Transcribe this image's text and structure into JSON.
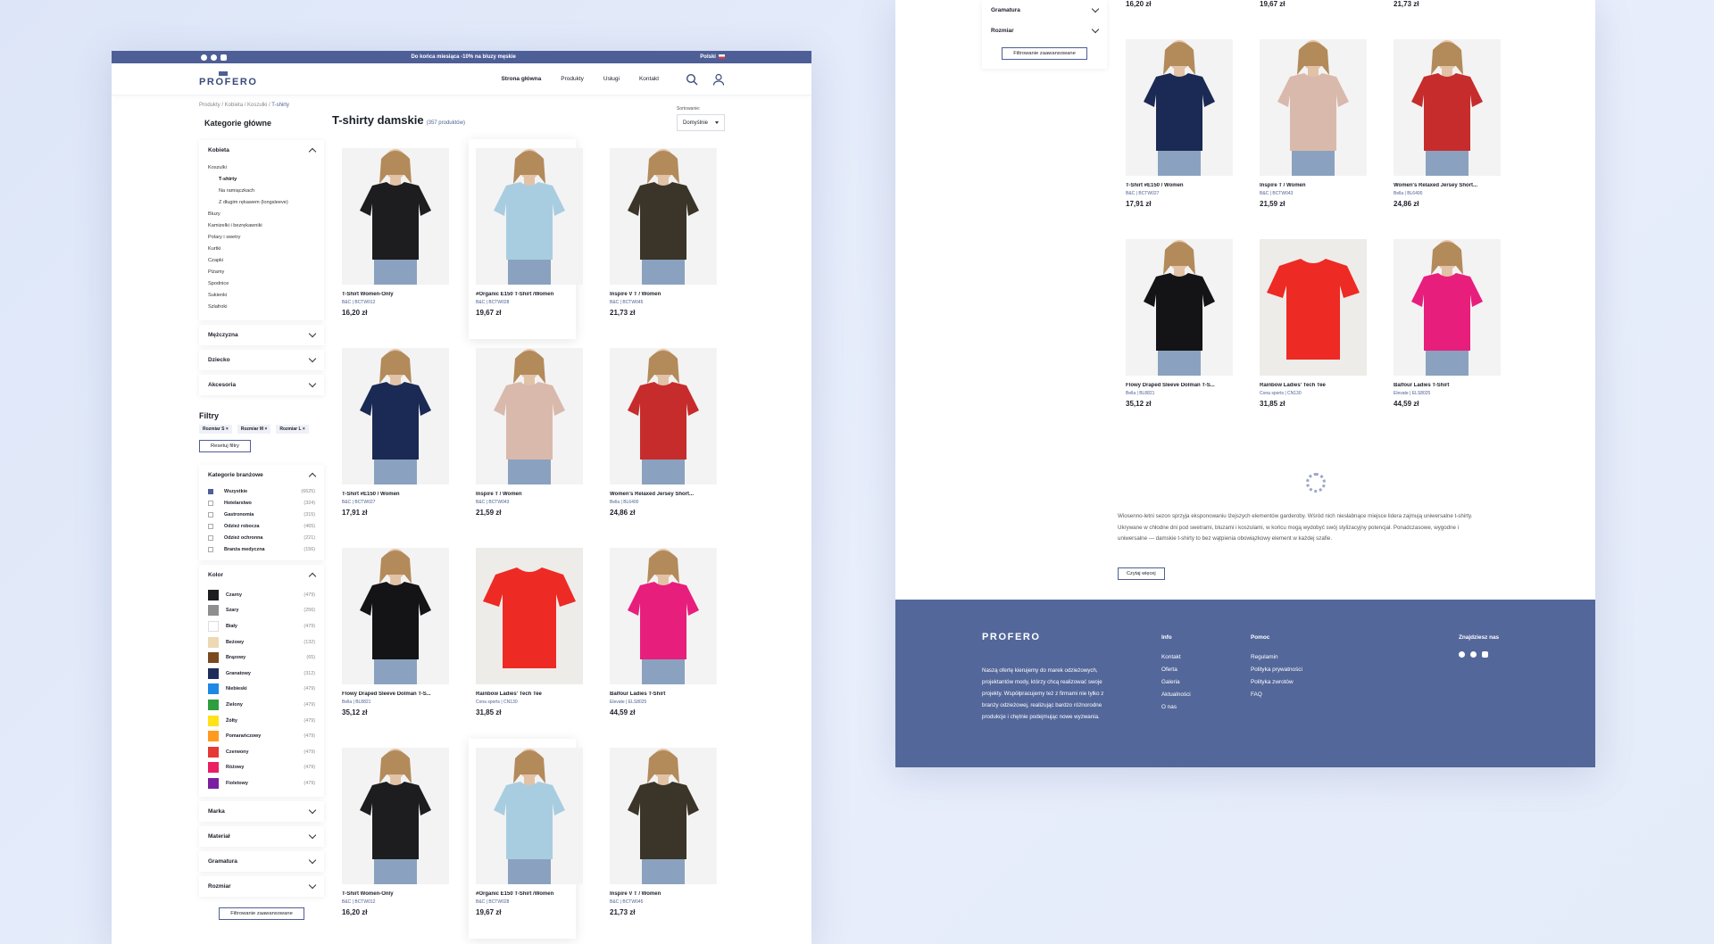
{
  "topbar": {
    "promo": "Do końca miesiąca -10% na bluzy męskie",
    "lang": "Polski"
  },
  "brand": {
    "logo": "PROFERO",
    "accent": "#4d5f96",
    "footer_bg": "#53679a"
  },
  "nav": {
    "items": [
      "Strona główna",
      "Produkty",
      "Usługi",
      "Kontakt"
    ],
    "active": "Strona główna",
    "icons": [
      "search-icon",
      "user-icon"
    ]
  },
  "breadcrumb": {
    "path": "Produkty / Kobieta / Koszulki / ",
    "current": "T-shirty"
  },
  "sidebar": {
    "heading": "Kategorie główne",
    "kobieta": "Kobieta",
    "tree": [
      "Koszulki",
      "T-shirty",
      "Na ramiączkach",
      "Z długim rękawem (longsleeve)",
      "Bluzy",
      "Kamizelki i bezrękawniki",
      "Polary i swetry",
      "Kurtki",
      "Czapki",
      "Piżamy",
      "Spodnice",
      "Sukienki",
      "Szlafroki"
    ],
    "other_cats": [
      "Mężczyzna",
      "Dziecko",
      "Akcesoria"
    ],
    "filters_heading": "Filtry",
    "chips": [
      "Rozmiar S",
      "Rozmiar M",
      "Rozmiar L"
    ],
    "reset": "Resetuj filtry",
    "industry_heading": "Kategorie branżowe",
    "industry": [
      {
        "label": "Wszystkie",
        "count": "(6625)",
        "on": true
      },
      {
        "label": "Hotelarstwo",
        "count": "(324)",
        "on": false
      },
      {
        "label": "Gastronomia",
        "count": "(315)",
        "on": false
      },
      {
        "label": "Odzież robocza",
        "count": "(465)",
        "on": false
      },
      {
        "label": "Odzież ochronna",
        "count": "(221)",
        "on": false
      },
      {
        "label": "Branża medyczna",
        "count": "(156)",
        "on": false
      }
    ],
    "color_heading": "Kolor",
    "colors": [
      {
        "label": "Czarny",
        "count": "(479)",
        "hex": "#1d1d1f"
      },
      {
        "label": "Szary",
        "count": "(256)",
        "hex": "#8e8e8e"
      },
      {
        "label": "Biały",
        "count": "(479)",
        "hex": "#ffffff"
      },
      {
        "label": "Beżowy",
        "count": "(132)",
        "hex": "#ecd9b4"
      },
      {
        "label": "Brązowy",
        "count": "(65)",
        "hex": "#7a4a1e"
      },
      {
        "label": "Granatowy",
        "count": "(312)",
        "hex": "#1f2d5a"
      },
      {
        "label": "Niebieski",
        "count": "(479)",
        "hex": "#1e88e5"
      },
      {
        "label": "Zielony",
        "count": "(479)",
        "hex": "#2e9e3e"
      },
      {
        "label": "Żółty",
        "count": "(479)",
        "hex": "#ffe21a"
      },
      {
        "label": "Pomarańczowy",
        "count": "(479)",
        "hex": "#ff9a1f"
      },
      {
        "label": "Czerwony",
        "count": "(479)",
        "hex": "#e53935"
      },
      {
        "label": "Różowy",
        "count": "(479)",
        "hex": "#e91e63"
      },
      {
        "label": "Fioletowy",
        "count": "(479)",
        "hex": "#7b1fa2"
      }
    ],
    "more": [
      "Marka",
      "Materiał",
      "Gramatura",
      "Rozmiar"
    ],
    "advanced": "Filtrowanie zaawansowane"
  },
  "listing": {
    "title": "T-shirty damskie",
    "count": "(357 produktów)",
    "sort_label": "Sortowanie:",
    "sort_value": "Domyślnie"
  },
  "products": [
    {
      "name": "T-Shirt Women-Only",
      "sku": "B&C | BCTW012",
      "price": "16,20 zł",
      "color": "#1d1d1f"
    },
    {
      "name": "#Organic E150 T-Shirt /Women",
      "sku": "B&C | BCTW028",
      "price": "19,67 zł",
      "color": "#a9cde0"
    },
    {
      "name": "Inspire V T / Women",
      "sku": "B&C | BCTW045",
      "price": "21,73 zł",
      "color": "#3a3528"
    },
    {
      "name": "T-Shirt #E150 / Women",
      "sku": "B&C | BCTW027",
      "price": "17,91 zł",
      "color": "#1b2a54"
    },
    {
      "name": "Inspire T / Women",
      "sku": "B&C | BCTW043",
      "price": "21,59 zł",
      "color": "#d9b9ac"
    },
    {
      "name": "Women's Relaxed Jersey Short...",
      "sku": "Bella | BL6400",
      "price": "24,86 zł",
      "color": "#c72c2c"
    },
    {
      "name": "Flowy Draped Sleeve Dolman T-S...",
      "sku": "Bella | BL8821",
      "price": "35,12 zł",
      "color": "#141416"
    },
    {
      "name": "Rainbow Ladies' Tech Tee",
      "sku": "Cona sports | CN130",
      "price": "31,85 zł",
      "color": "#ee2a24"
    },
    {
      "name": "Balfour Ladies T-Shirt",
      "sku": "Elevate | ELS8025",
      "price": "44,59 zł",
      "color": "#e81e7d"
    }
  ],
  "description": "Wiosenno-letni sezon sprzyja eksponowaniu lżejszych elementów garderoby. Wśród nich niesłabnące miejsce lidera zajmują uniwersalne t-shirty. Ukrywane w chłodne dni pod swetrami, bluzami i koszulami, w końcu mogą wydobyć swój stylizacyjny potencjał. Ponadczasowe, wygodne i uniwersalne — damskie t-shirty to bez wątpienia obowiązkowy element w każdej szafie.",
  "read_more": "Czytaj więcej",
  "footer": {
    "about": "Naszą ofertę kierujemy do marek odzieżowych, projektantów mody, którzy chcą realizować swoje projekty. Współpracujemy też z firmami nie tylko z branży odzieżowej, realizując bardzo różnorodne produkcje i chętnie podejmując nowe wyzwania.",
    "info_h": "Info",
    "info": [
      "Kontakt",
      "Oferta",
      "Galeria",
      "Aktualności",
      "O nas"
    ],
    "help_h": "Pomoc",
    "help": [
      "Regulamin",
      "Polityka prywatności",
      "Polityka zwrotów",
      "FAQ"
    ],
    "find_h": "Znajdziesz nas",
    "social": [
      "facebook-icon",
      "instagram-icon",
      "youtube-icon"
    ]
  }
}
